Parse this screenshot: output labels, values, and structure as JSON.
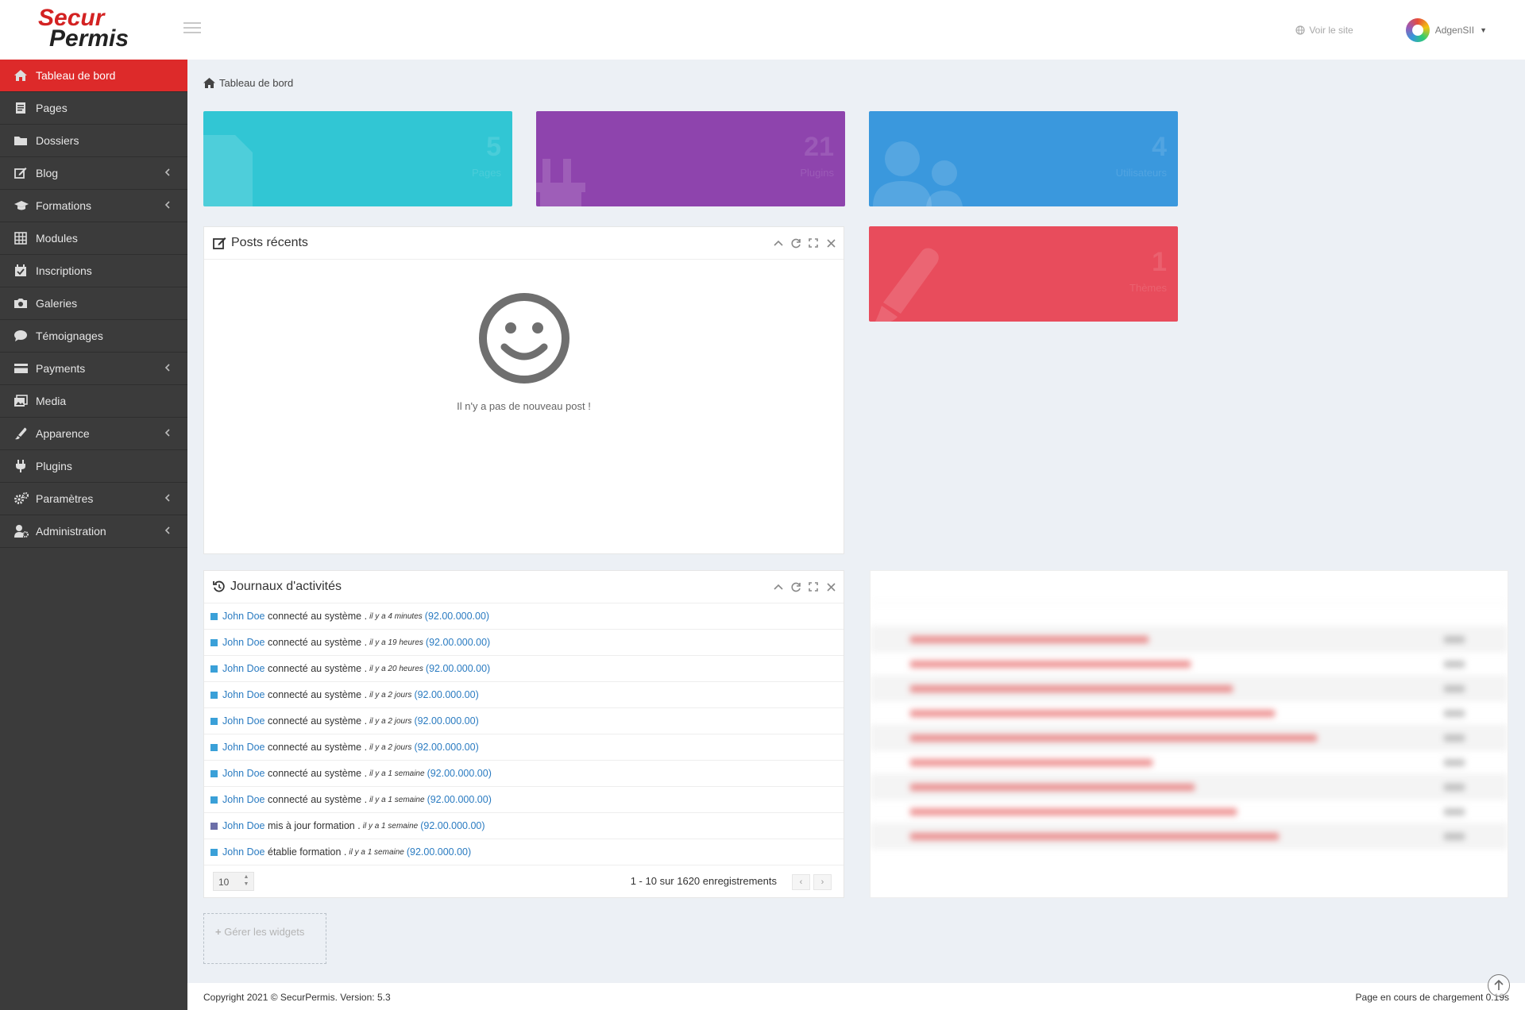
{
  "brand": {
    "logo_text_top": "Secur",
    "logo_text_bottom": "Permis"
  },
  "topbar": {
    "visit_site": "Voir le site",
    "username": "AdgenSII"
  },
  "sidebar": {
    "items": [
      {
        "label": "Tableau de bord",
        "icon": "home-icon",
        "active": true,
        "has_children": false
      },
      {
        "label": "Pages",
        "icon": "page-icon",
        "has_children": false
      },
      {
        "label": "Dossiers",
        "icon": "folder-icon",
        "has_children": false
      },
      {
        "label": "Blog",
        "icon": "edit-icon",
        "has_children": true
      },
      {
        "label": "Formations",
        "icon": "graduation-cap-icon",
        "has_children": true
      },
      {
        "label": "Modules",
        "icon": "grid-icon",
        "has_children": false
      },
      {
        "label": "Inscriptions",
        "icon": "calendar-check-icon",
        "has_children": false
      },
      {
        "label": "Galeries",
        "icon": "camera-icon",
        "has_children": false
      },
      {
        "label": "Témoignages",
        "icon": "comment-icon",
        "has_children": false
      },
      {
        "label": "Payments",
        "icon": "credit-card-icon",
        "has_children": true
      },
      {
        "label": "Media",
        "icon": "images-icon",
        "has_children": false
      },
      {
        "label": "Apparence",
        "icon": "brush-icon",
        "has_children": true
      },
      {
        "label": "Plugins",
        "icon": "plug-icon",
        "has_children": false
      },
      {
        "label": "Paramètres",
        "icon": "cogs-icon",
        "has_children": true
      },
      {
        "label": "Administration",
        "icon": "user-cog-icon",
        "has_children": true
      }
    ]
  },
  "breadcrumb": {
    "current": "Tableau de bord"
  },
  "stats": [
    {
      "value": "5",
      "label": "Pages",
      "color": "#31c6d4"
    },
    {
      "value": "21",
      "label": "Plugins",
      "color": "#8e44ad"
    },
    {
      "value": "4",
      "label": "Utilisateurs",
      "color": "#3a98dd"
    },
    {
      "value": "1",
      "label": "Thèmes",
      "color": "#e84c5c"
    }
  ],
  "posts_widget": {
    "title": "Posts récents",
    "empty_message": "Il n'y a pas de nouveau post !"
  },
  "activity_widget": {
    "title": "Journaux d'activités",
    "rows": [
      {
        "user": "John Doe",
        "action": "connecté au système",
        "time": "il y a 4 minutes",
        "ip": "(92.00.000.00)",
        "color": "#3aa0d8"
      },
      {
        "user": "John Doe",
        "action": "connecté au système",
        "time": "il y a 19 heures",
        "ip": "(92.00.000.00)",
        "color": "#3aa0d8"
      },
      {
        "user": "John Doe",
        "action": "connecté au système",
        "time": "il y a 20 heures",
        "ip": "(92.00.000.00)",
        "color": "#3aa0d8"
      },
      {
        "user": "John Doe",
        "action": "connecté au système",
        "time": "il y a 2 jours",
        "ip": "(92.00.000.00)",
        "color": "#3aa0d8"
      },
      {
        "user": "John Doe",
        "action": "connecté au système",
        "time": "il y a 2 jours",
        "ip": "(92.00.000.00)",
        "color": "#3aa0d8"
      },
      {
        "user": "John Doe",
        "action": "connecté au système",
        "time": "il y a 2 jours",
        "ip": "(92.00.000.00)",
        "color": "#3aa0d8"
      },
      {
        "user": "John Doe",
        "action": "connecté au système",
        "time": "il y a 1 semaine",
        "ip": "(92.00.000.00)",
        "color": "#3aa0d8"
      },
      {
        "user": "John Doe",
        "action": "connecté au système",
        "time": "il y a 1 semaine",
        "ip": "(92.00.000.00)",
        "color": "#3aa0d8"
      },
      {
        "user": "John Doe",
        "action": "mis à jour formation",
        "time": "il y a 1 semaine",
        "ip": "(92.00.000.00)",
        "color": "#6c6fa8"
      },
      {
        "user": "John Doe",
        "action": "établie formation",
        "time": "il y a 1 semaine",
        "ip": "(92.00.000.00)",
        "color": "#3aa0d8"
      }
    ],
    "per_page": "10",
    "pagination_info": "1 - 10 sur 1620 enregistrements"
  },
  "manage_widgets": "Gérer les widgets",
  "footer": {
    "copyright": "Copyright 2021 © SecurPermis. Version: 5.3",
    "loading": "Page en cours de chargement 0.19s"
  }
}
